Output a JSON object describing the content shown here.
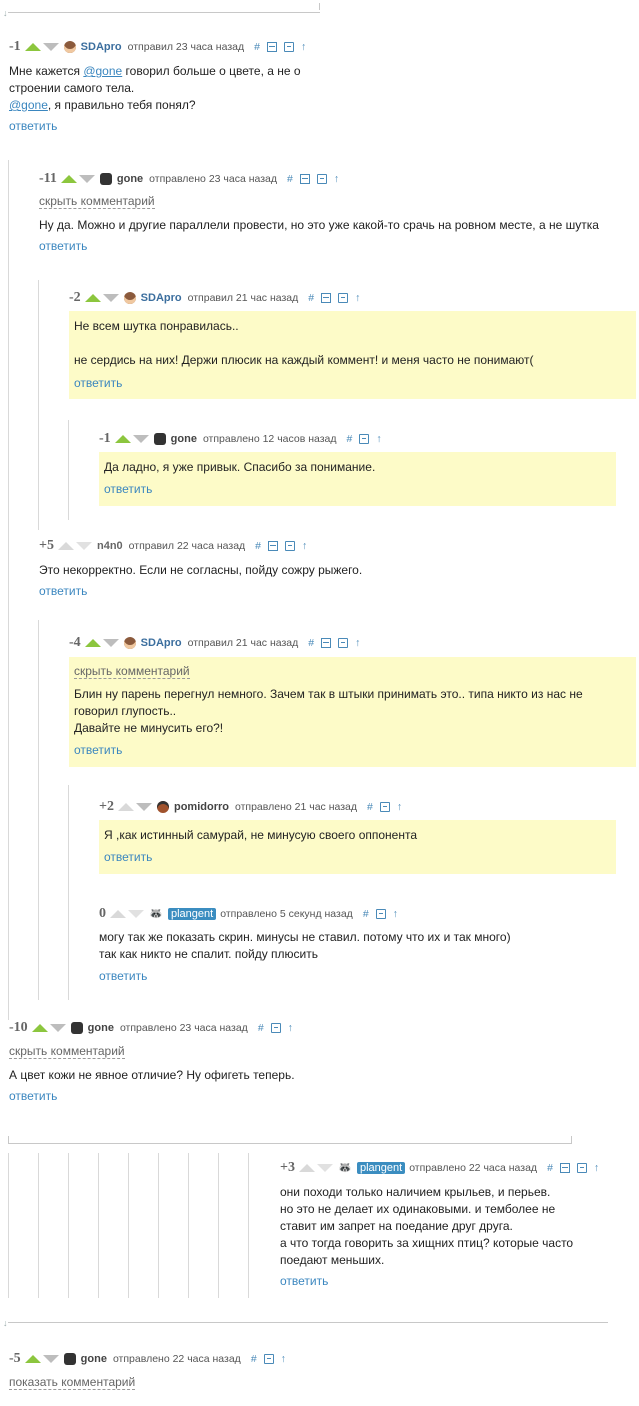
{
  "comments": [
    {
      "rating": "-1",
      "user": "SDApro",
      "meta": "отправил 23 часа назад",
      "lines": [
        "Мне кажется @gone говорил больше о цвете, а не о",
        "строении самого тела.",
        "@gone, я правильно тебя понял?"
      ],
      "reply": "ответить"
    },
    {
      "rating": "-11",
      "user": "gone",
      "meta": "отправлено 23 часа назад",
      "hide": "скрыть комментарий",
      "lines": [
        "Ну да. Можно и другие параллели провести, но это уже какой-то срачь на ровном месте, а не шутка"
      ],
      "reply": "ответить"
    },
    {
      "rating": "-2",
      "user": "SDApro",
      "meta": "отправил 21 час назад",
      "lines": [
        "Не всем шутка понравилась..",
        "",
        "не сердись на них! Держи плюсик на каждый коммент! и меня часто не понимают("
      ],
      "reply": "ответить"
    },
    {
      "rating": "-1",
      "user": "gone",
      "meta": "отправлено 12 часов назад",
      "lines": [
        "Да ладно, я уже привык. Спасибо за понимание."
      ],
      "reply": "ответить"
    },
    {
      "rating": "+5",
      "user": "n4n0",
      "meta": "отправил 22 часа назад",
      "lines": [
        "Это некорректно. Если не согласны, пойду сожру рыжего."
      ],
      "reply": "ответить"
    },
    {
      "rating": "-4",
      "user": "SDApro",
      "meta": "отправил 21 час назад",
      "hide": "скрыть комментарий",
      "lines": [
        "Блин ну парень перегнул немного. Зачем так в штыки принимать это.. типа никто из нас не",
        "говорил глупость..",
        "Давайте не минусить его?!"
      ],
      "reply": "ответить"
    },
    {
      "rating": "+2",
      "user": "pomidorro",
      "meta": "отправлено 21 час назад",
      "lines": [
        "Я ,как истинный самурай, не минусую своего оппонента"
      ],
      "reply": "ответить"
    },
    {
      "rating": "0",
      "user": "plangent",
      "meta": "отправлено 5 секунд назад",
      "lines": [
        "могу так же показать скрин. минусы не ставил. потому что их и так много)",
        "так как никто не спалит. пойду плюсить"
      ],
      "reply": "ответить"
    },
    {
      "rating": "-10",
      "user": "gone",
      "meta": "отправлено 23 часа назад",
      "hide": "скрыть комментарий",
      "lines": [
        "А цвет кожи не явное отличие? Ну офигеть теперь."
      ],
      "reply": "ответить"
    },
    {
      "rating": "+3",
      "user": "plangent",
      "meta": "отправлено 22 часа назад",
      "lines": [
        "они походи только наличием крыльев, и перьев.",
        "но это не делает их одинаковыми. и темболее не",
        "ставит им запрет на поедание друг друга.",
        "а что тогда говорить за хищних птиц? которые часто",
        "поедают меньших."
      ],
      "reply": "ответить"
    },
    {
      "rating": "-5",
      "user": "gone",
      "meta": "отправлено 22 часа назад",
      "show": "показать комментарий"
    }
  ],
  "icons": {
    "hash": "#",
    "up": "↑",
    "down_arrow": "↓",
    "plangent_avatar": "🦝"
  }
}
